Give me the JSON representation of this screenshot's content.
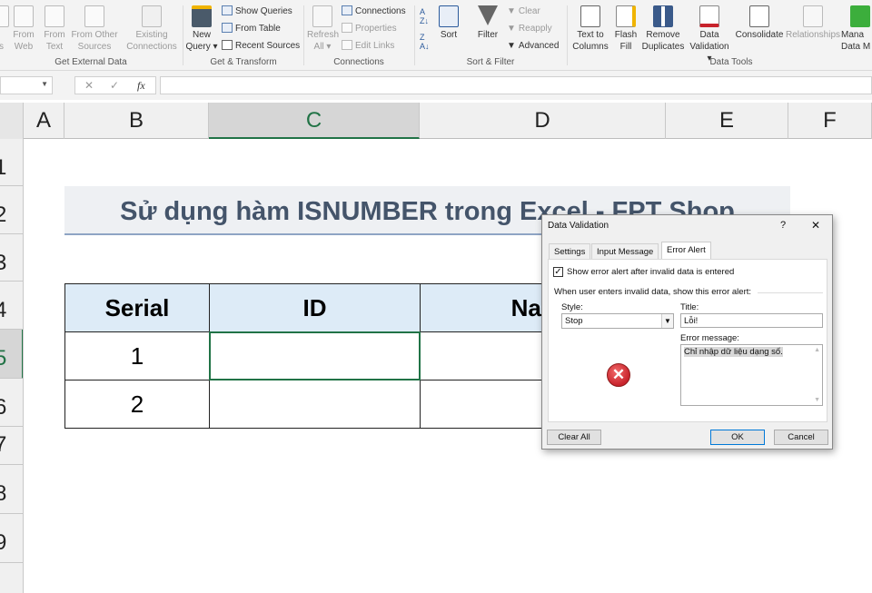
{
  "ribbon": {
    "get_external": {
      "label": "Get External Data",
      "items": [
        {
          "label1": "",
          "label2": "ss"
        },
        {
          "label1": "From",
          "label2": "Web"
        },
        {
          "label1": "From",
          "label2": "Text"
        },
        {
          "label1": "From Other",
          "label2": "Sources"
        },
        {
          "label1": "Existing",
          "label2": "Connections"
        }
      ]
    },
    "get_transform": {
      "label": "Get & Transform",
      "new_query1": "New",
      "new_query2": "Query",
      "show_queries": "Show Queries",
      "from_table": "From Table",
      "recent_sources": "Recent Sources"
    },
    "connections": {
      "label": "Connections",
      "refresh1": "Refresh",
      "refresh2": "All",
      "connections": "Connections",
      "properties": "Properties",
      "edit_links": "Edit Links"
    },
    "sort_filter": {
      "label": "Sort & Filter",
      "sort": "Sort",
      "filter": "Filter",
      "clear": "Clear",
      "reapply": "Reapply",
      "advanced": "Advanced"
    },
    "data_tools": {
      "label": "Data Tools",
      "items": [
        {
          "label1": "Text to",
          "label2": "Columns"
        },
        {
          "label1": "Flash",
          "label2": "Fill"
        },
        {
          "label1": "Remove",
          "label2": "Duplicates"
        },
        {
          "label1": "Data",
          "label2": "Validation"
        },
        {
          "label1": "Consolidate",
          "label2": ""
        },
        {
          "label1": "Relationships",
          "label2": ""
        },
        {
          "label1": "Mana",
          "label2": "Data M"
        }
      ]
    }
  },
  "formula_bar": {
    "fx": "fx",
    "cancel": "✕",
    "enter": "✓",
    "value": ""
  },
  "columns": [
    "A",
    "B",
    "C",
    "D",
    "E",
    "F"
  ],
  "rows": [
    "1",
    "2",
    "3",
    "4",
    "5",
    "6",
    "7",
    "8",
    "9"
  ],
  "sheet": {
    "title": "Sử dụng hàm ISNUMBER trong Excel - FPT Shop",
    "headers": [
      "Serial",
      "ID",
      "Name"
    ],
    "rows": [
      [
        "1",
        "",
        ""
      ],
      [
        "2",
        "",
        ""
      ]
    ]
  },
  "dialog": {
    "title": "Data Validation",
    "help": "?",
    "close": "✕",
    "tabs": [
      "Settings",
      "Input Message",
      "Error Alert"
    ],
    "active_tab": "Error Alert",
    "show_alert_label": "Show error alert after invalid data is entered",
    "show_alert_checked": true,
    "section_label": "When user enters invalid data, show this error alert:",
    "style_label": "Style:",
    "style_value": "Stop",
    "title_label": "Title:",
    "title_value": "Lỗi!",
    "message_label": "Error message:",
    "message_value": "Chỉ nhập dữ liệu dạng số.",
    "clear_all": "Clear All",
    "ok": "OK",
    "cancel": "Cancel"
  },
  "colors": {
    "accent": "#217346",
    "stop_icon": "#c8232c",
    "header_fill": "#ddebf7",
    "title_text": "#44546a"
  }
}
